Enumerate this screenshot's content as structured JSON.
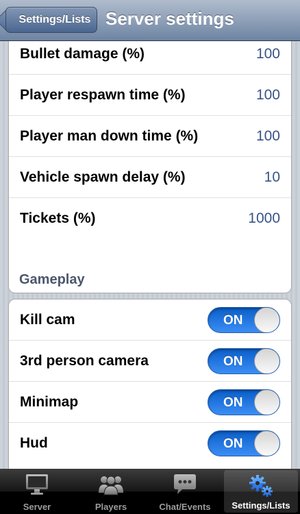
{
  "navbar": {
    "back_label": "Settings/Lists",
    "title": "Server settings"
  },
  "settings_rows": [
    {
      "label": "Bullet damage (%)",
      "value": "100"
    },
    {
      "label": "Player respawn time (%)",
      "value": "100"
    },
    {
      "label": "Player man down time (%)",
      "value": "100"
    },
    {
      "label": "Vehicle spawn delay (%)",
      "value": "10"
    },
    {
      "label": "Tickets (%)",
      "value": "1000"
    }
  ],
  "gameplay": {
    "header": "Gameplay",
    "rows": [
      {
        "label": "Kill cam",
        "state": "ON"
      },
      {
        "label": "3rd person camera",
        "state": "ON"
      },
      {
        "label": "Minimap",
        "state": "ON"
      },
      {
        "label": "Hud",
        "state": "ON"
      }
    ]
  },
  "tabbar": {
    "tabs": [
      {
        "label": "Server",
        "icon": "monitor-icon"
      },
      {
        "label": "Players",
        "icon": "players-icon"
      },
      {
        "label": "Chat/Events",
        "icon": "chat-bubble-icon"
      },
      {
        "label": "Settings/Lists",
        "icon": "gears-icon"
      }
    ],
    "active_index": 3
  },
  "colors": {
    "value_text": "#385487",
    "switch_on": "#1a6fe0",
    "navbar": "#6d84a2"
  }
}
